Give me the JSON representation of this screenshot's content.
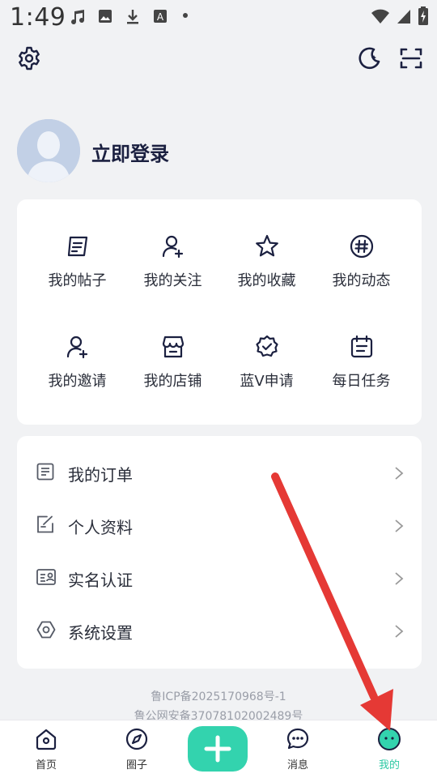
{
  "status_bar": {
    "time": "1:49",
    "icons": [
      "music-note-icon",
      "image-icon",
      "download-icon",
      "a-box-icon",
      "dot-icon",
      "wifi-icon",
      "signal-icon",
      "battery-charging-icon"
    ]
  },
  "header": {
    "settings_icon": "gear-icon",
    "night_mode_icon": "moon-icon",
    "scan_icon": "scan-icon"
  },
  "profile": {
    "login_text": "立即登录"
  },
  "quick_grid": [
    {
      "label": "我的帖子",
      "icon": "posts-icon"
    },
    {
      "label": "我的关注",
      "icon": "follow-icon"
    },
    {
      "label": "我的收藏",
      "icon": "star-icon"
    },
    {
      "label": "我的动态",
      "icon": "hash-icon"
    },
    {
      "label": "我的邀请",
      "icon": "invite-icon"
    },
    {
      "label": "我的店铺",
      "icon": "shop-icon"
    },
    {
      "label": "蓝V申请",
      "icon": "badge-check-icon"
    },
    {
      "label": "每日任务",
      "icon": "calendar-icon"
    }
  ],
  "menu_list": [
    {
      "label": "我的订单",
      "icon": "order-icon"
    },
    {
      "label": "个人资料",
      "icon": "edit-profile-icon"
    },
    {
      "label": "实名认证",
      "icon": "id-card-icon"
    },
    {
      "label": "系统设置",
      "icon": "hexagon-settings-icon"
    }
  ],
  "footer": {
    "icp_line1": "鲁ICP备2025170968号-1",
    "icp_line2": "鲁公网安备37078102002489号"
  },
  "bottom_nav": [
    {
      "label": "首页",
      "icon": "home-icon"
    },
    {
      "label": "圈子",
      "icon": "compass-icon"
    },
    {
      "label": "",
      "icon": "plus-icon"
    },
    {
      "label": "消息",
      "icon": "chat-icon"
    },
    {
      "label": "我的",
      "icon": "me-face-icon"
    }
  ],
  "colors": {
    "accent": "#2ec9a4",
    "fab": "#33d3ae",
    "annotation_arrow": "#e53935"
  }
}
